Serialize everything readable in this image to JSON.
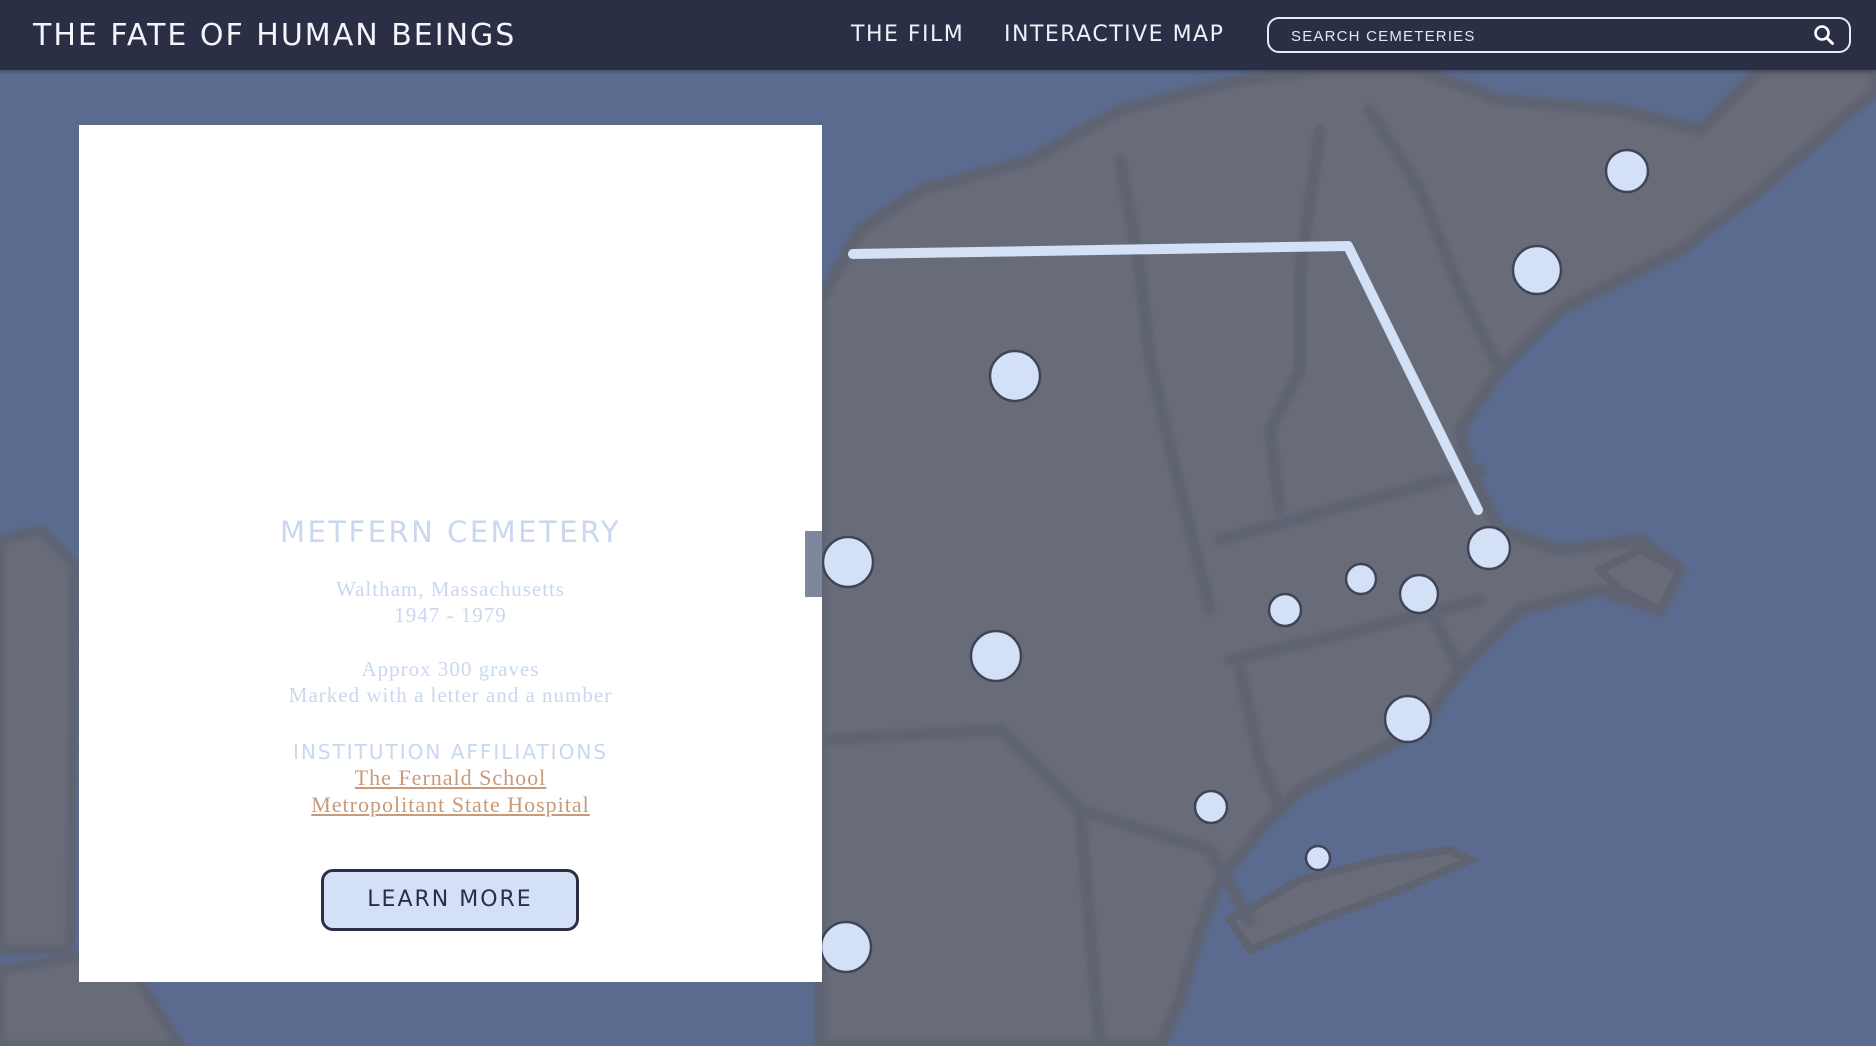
{
  "header": {
    "site_title": "THE FATE OF HUMAN BEINGS",
    "nav": {
      "film": "THE FILM",
      "map": "INTERACTIVE MAP"
    },
    "search": {
      "placeholder": "SEARCH CEMETERIES",
      "value": ""
    }
  },
  "panel": {
    "name": "METFERN CEMETERY",
    "location": "Waltham, Massachusetts",
    "years": "1947 - 1979",
    "graves": "Approx 300 graves",
    "marking": "Marked with a letter and a number",
    "affiliations_heading": "INSTITUTION AFFILIATIONS",
    "affiliations": [
      "The Fernald School",
      "Metropolitant State Hospital"
    ],
    "learn_more": "LEARN MORE"
  },
  "colors": {
    "nav_bg": "#2b2f45",
    "ocean": "#5a6b8f",
    "land": "#686c78",
    "marker": "#d3e0f5",
    "link": "#c99a78",
    "panel_text": "#c9d7f0"
  },
  "icons": {
    "search": "search-icon"
  }
}
